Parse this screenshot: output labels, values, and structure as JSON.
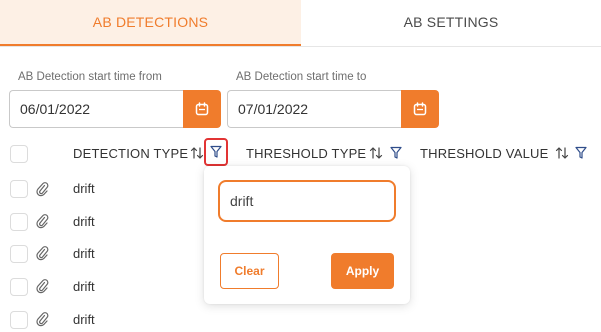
{
  "tabs": [
    {
      "label": "AB DETECTIONS",
      "active": true
    },
    {
      "label": "AB SETTINGS",
      "active": false
    }
  ],
  "date_range": {
    "start_label": "AB Detection start time from",
    "start_value": "06/01/2022",
    "end_label": "AB Detection start time to",
    "end_value": "07/01/2022"
  },
  "table": {
    "columns": [
      "DETECTION TYPE",
      "THRESHOLD TYPE",
      "THRESHOLD VALUE"
    ],
    "rows": [
      {
        "detection_type": "drift"
      },
      {
        "detection_type": "drift"
      },
      {
        "detection_type": "drift"
      },
      {
        "detection_type": "drift"
      },
      {
        "detection_type": "drift"
      }
    ]
  },
  "filter_popover": {
    "value": "drift",
    "clear_label": "Clear",
    "apply_label": "Apply"
  },
  "colors": {
    "accent": "#f07c2c",
    "active_tab_bg": "#fdf0e5",
    "focus_outline": "#e23434"
  },
  "icons": [
    "calendar-icon",
    "sort-icon",
    "filter-icon",
    "paperclip-icon"
  ]
}
